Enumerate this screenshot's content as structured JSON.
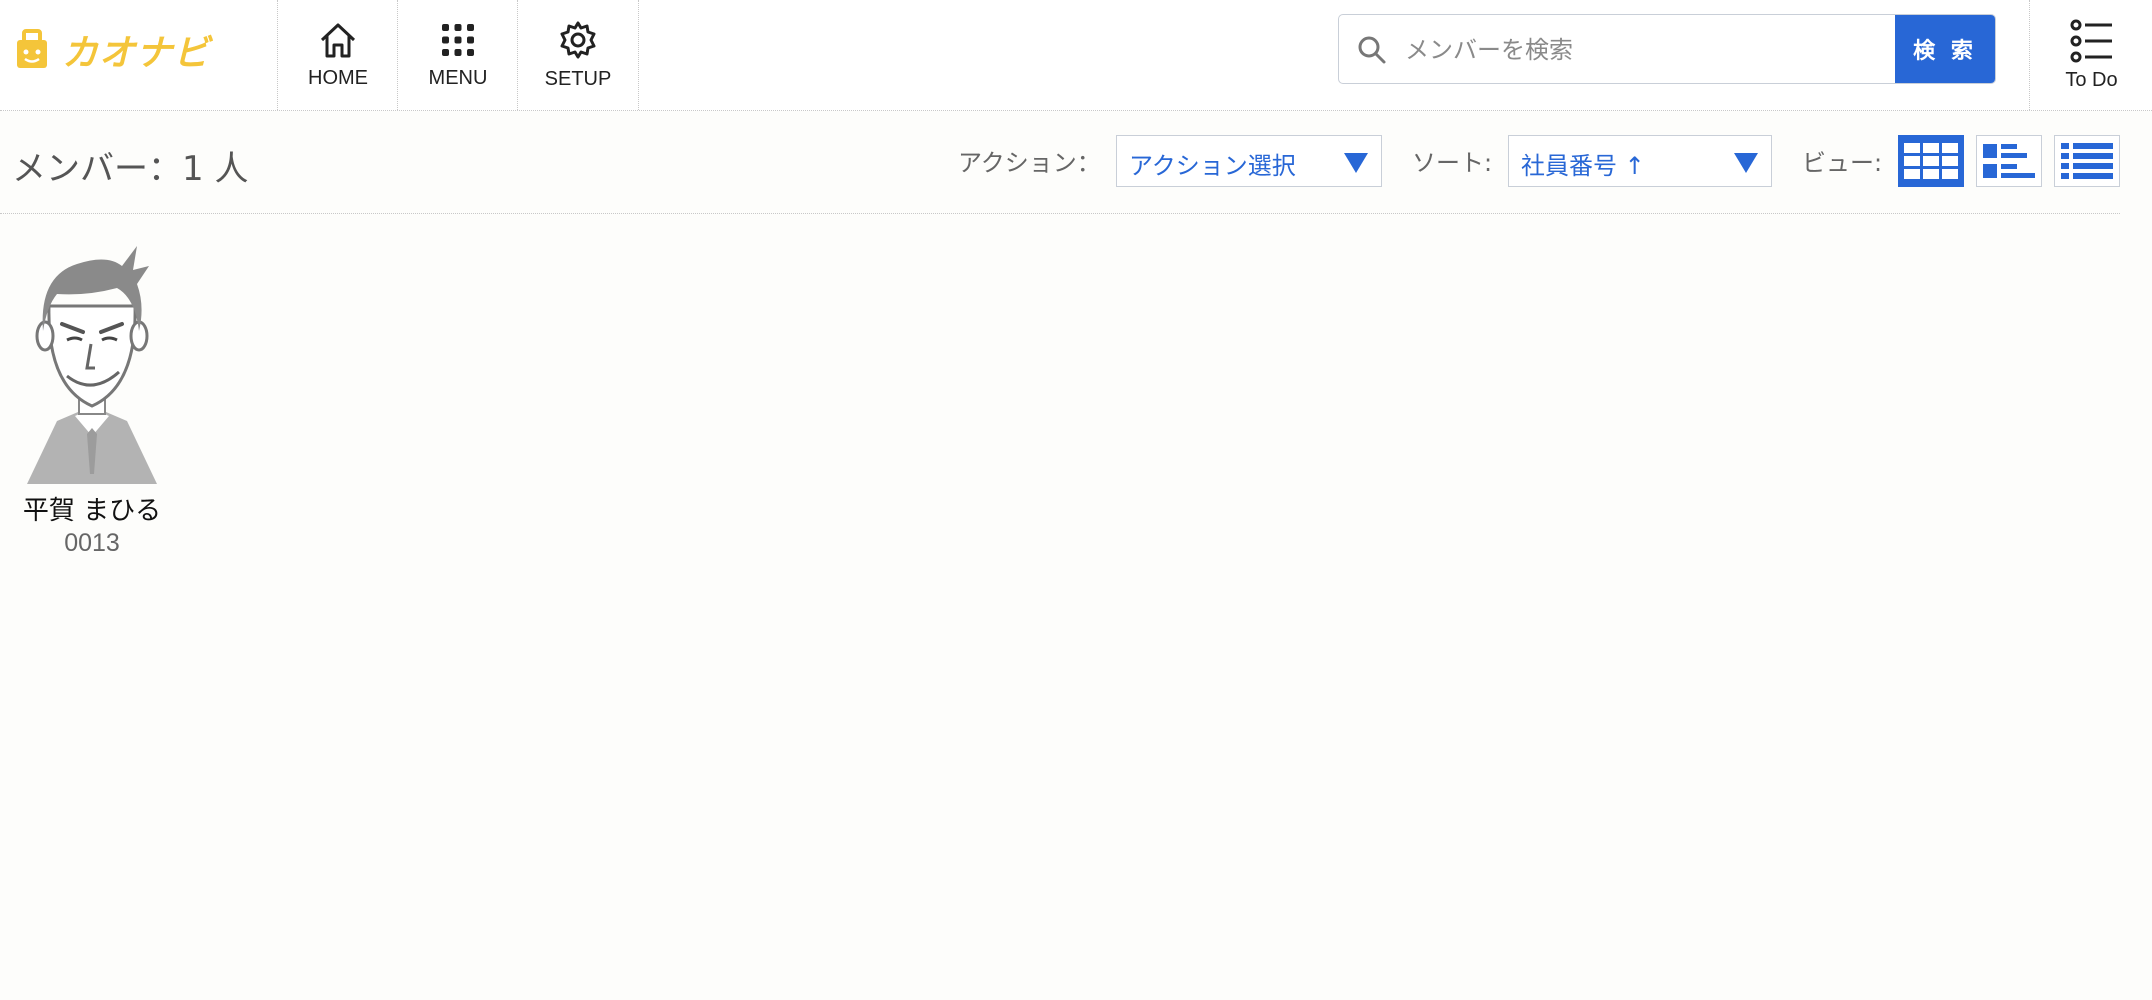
{
  "header": {
    "logo_text": "カオナビ",
    "nav": [
      {
        "label": "HOME",
        "icon": "home-icon"
      },
      {
        "label": "MENU",
        "icon": "grid-icon"
      },
      {
        "label": "SETUP",
        "icon": "gear-icon"
      }
    ],
    "search": {
      "placeholder": "メンバーを検索",
      "value": "",
      "button_label": "検 索"
    },
    "todo_label": "To Do"
  },
  "toolbar": {
    "member_count": "メンバー：1 人",
    "action_label": "アクション：",
    "action_value": "アクション選択",
    "sort_label": "ソート:",
    "sort_value": "社員番号 ↑",
    "view_label": "ビュー:",
    "views": [
      "grid-view",
      "detail-list-view",
      "list-view"
    ],
    "active_view": "grid-view"
  },
  "members": [
    {
      "name": "平賀 まひる",
      "employee_no": "0013",
      "avatar": "default-businessman-avatar"
    }
  ],
  "colors": {
    "accent": "#2867d6",
    "logo": "#f4c53a"
  }
}
